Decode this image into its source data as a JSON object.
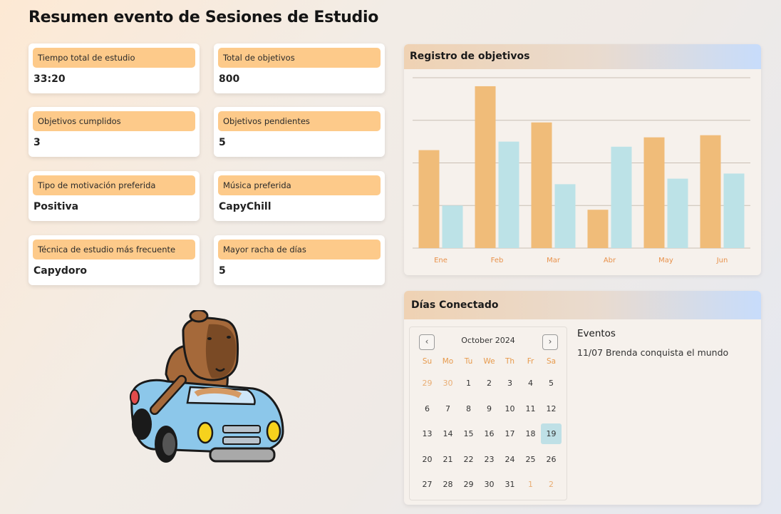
{
  "page": {
    "title": "Resumen evento de Sesiones de Estudio"
  },
  "stats": [
    {
      "label": "Tiempo total de estudio",
      "value": "33:20"
    },
    {
      "label": "Total de objetivos",
      "value": "800"
    },
    {
      "label": "Objetivos cumplidos",
      "value": "3"
    },
    {
      "label": "Objetivos pendientes",
      "value": "5"
    },
    {
      "label": "Tipo de motivación preferida",
      "value": "Positiva"
    },
    {
      "label": "Música preferida",
      "value": "CapyChill"
    },
    {
      "label": "Técnica de estudio más frecuente",
      "value": "Capydoro"
    },
    {
      "label": "Mayor racha de días",
      "value": "5"
    }
  ],
  "goals_panel": {
    "title": "Registro de objetivos"
  },
  "chart_data": {
    "type": "bar",
    "categories": [
      "Ene",
      "Feb",
      "Mar",
      "Abr",
      "May",
      "Jun"
    ],
    "series": [
      {
        "values": [
          2.3,
          3.8,
          2.95,
          0.9,
          2.6,
          2.65
        ],
        "color": "#f0bc79"
      },
      {
        "values": [
          1.0,
          2.5,
          1.5,
          2.38,
          1.63,
          1.75
        ],
        "color": "#bce2e7"
      }
    ],
    "ylim": [
      0,
      4
    ],
    "grid": true,
    "tick_color": "#e8914a"
  },
  "calendar_panel": {
    "title": "Días Conectado",
    "month_label": "October 2024",
    "prev_symbol": "‹",
    "next_symbol": "›",
    "weekdays": [
      "Su",
      "Mo",
      "Tu",
      "We",
      "Th",
      "Fr",
      "Sa"
    ],
    "weeks": [
      [
        "29",
        "30",
        "1",
        "2",
        "3",
        "4",
        "5"
      ],
      [
        "6",
        "7",
        "8",
        "9",
        "10",
        "11",
        "12"
      ],
      [
        "13",
        "14",
        "15",
        "16",
        "17",
        "18",
        "19"
      ],
      [
        "20",
        "21",
        "22",
        "23",
        "24",
        "25",
        "26"
      ],
      [
        "27",
        "28",
        "29",
        "30",
        "31",
        "1",
        "2"
      ]
    ],
    "selected_day": "19",
    "events_title": "Eventos",
    "events": [
      "11/07 Brenda conquista el mundo"
    ]
  },
  "mascot": {
    "icon": "capybara-car-illustration"
  }
}
